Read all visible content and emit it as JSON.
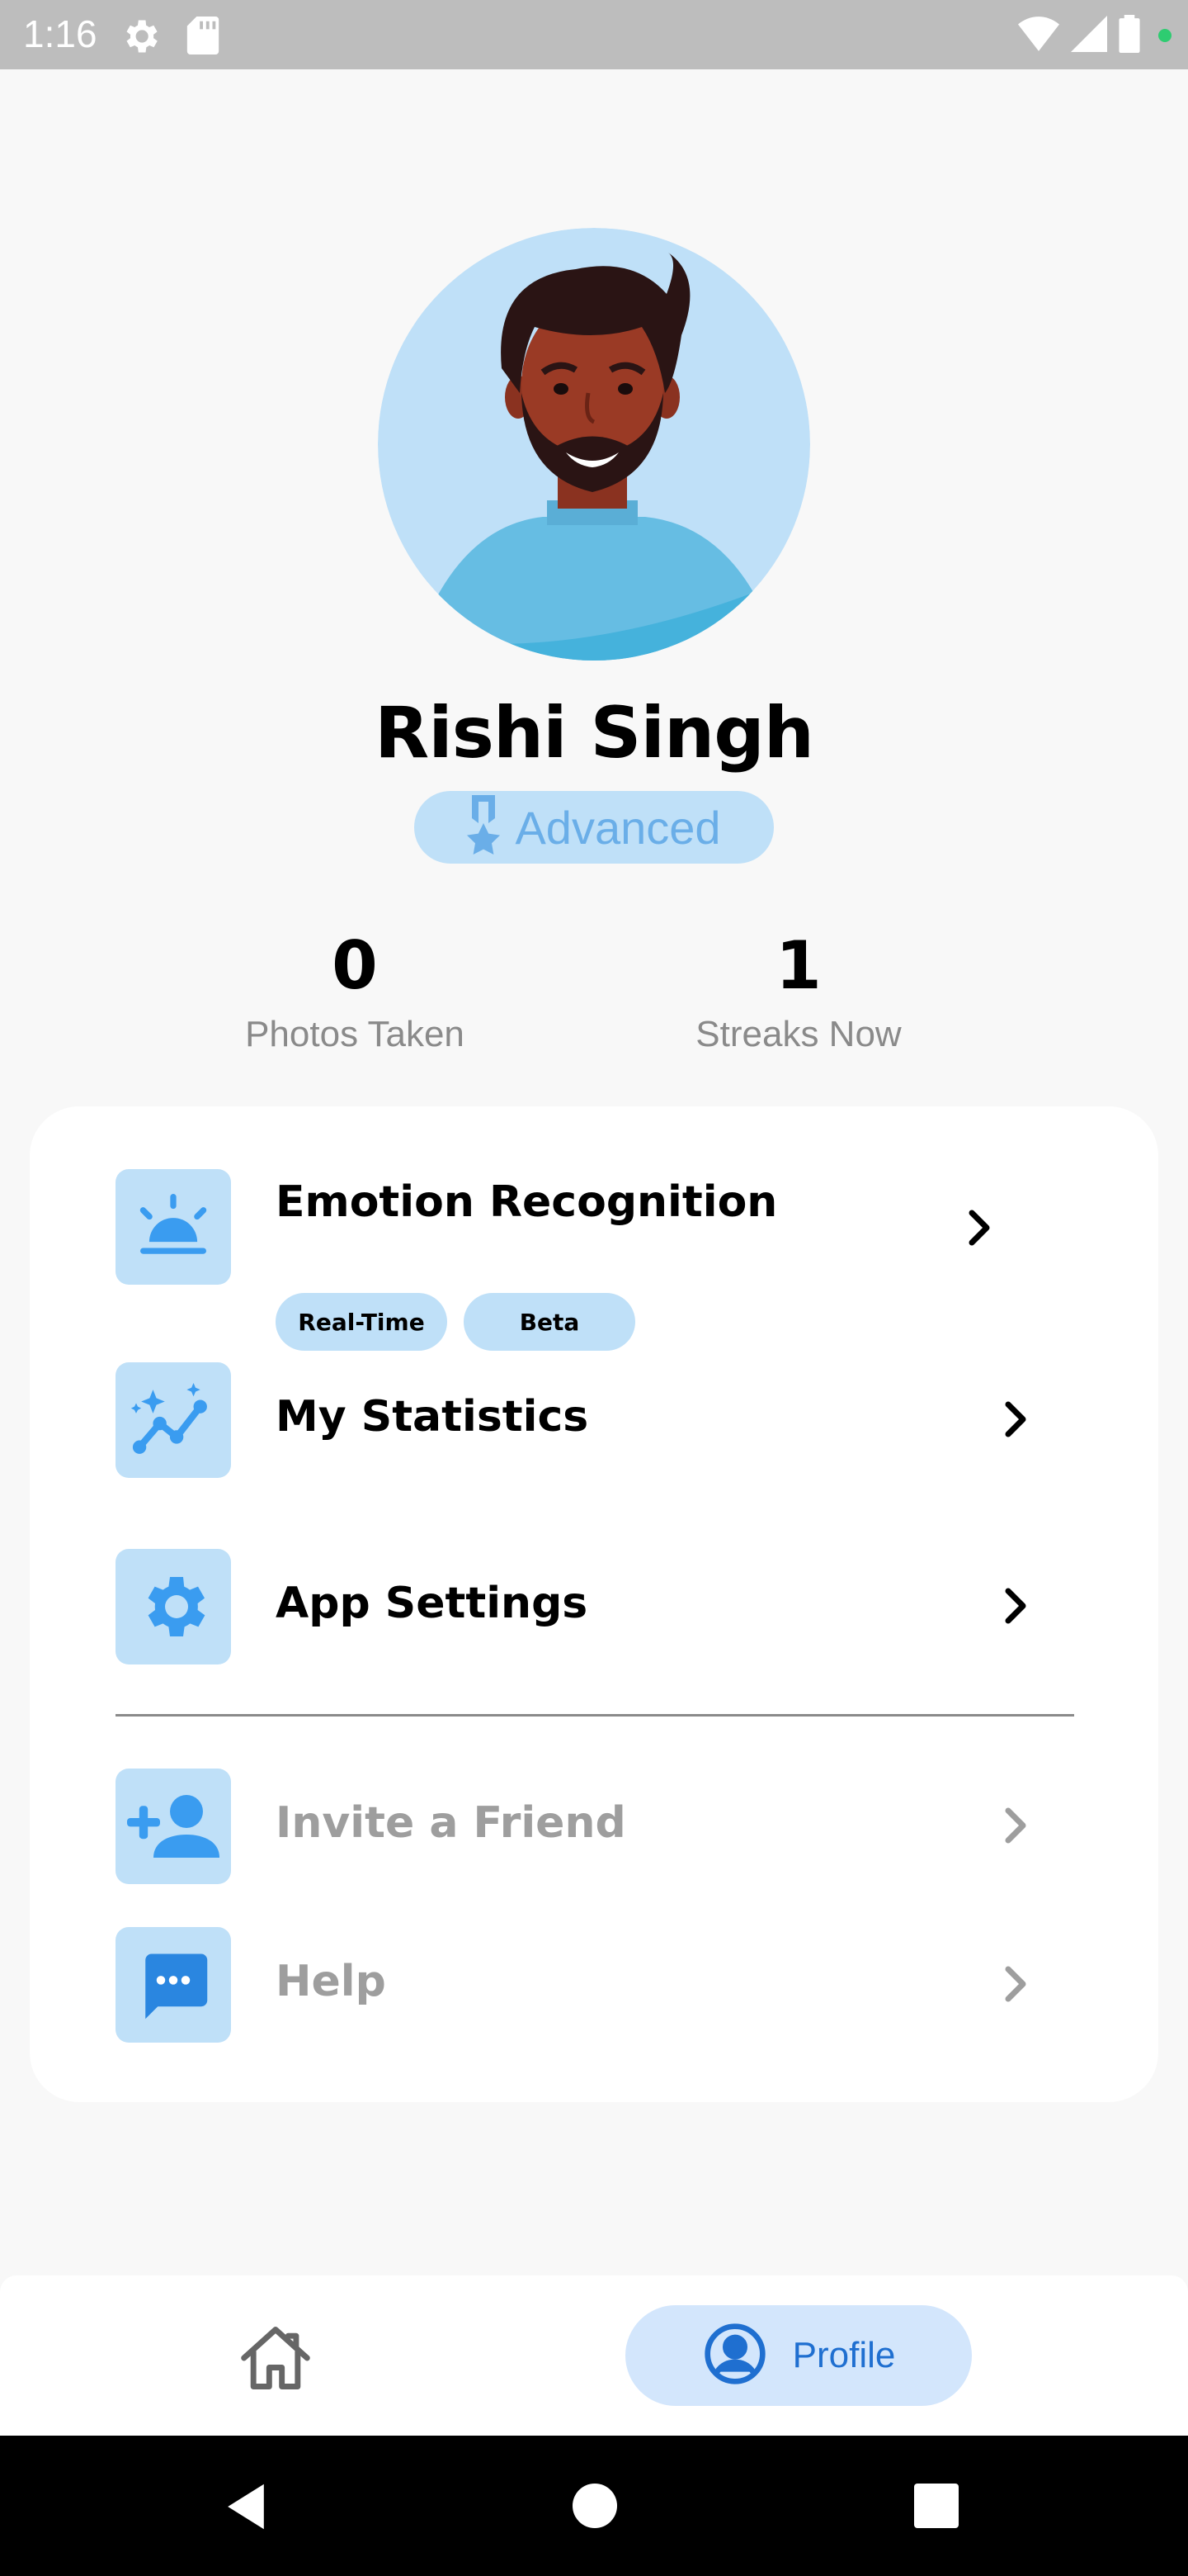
{
  "status_bar": {
    "time": "1:16"
  },
  "profile": {
    "name": "Rishi Singh",
    "level": "Advanced"
  },
  "stats": [
    {
      "value": "0",
      "label": "Photos Taken"
    },
    {
      "value": "1",
      "label": "Streaks Now"
    }
  ],
  "menu": {
    "items": [
      {
        "label": "Emotion Recognition",
        "icon": "sunrise-alarm-icon",
        "tags": [
          "Real-Time",
          "Beta"
        ]
      },
      {
        "label": "My Statistics",
        "icon": "chart-sparkle-icon"
      },
      {
        "label": "App Settings",
        "icon": "gear-icon"
      },
      {
        "label": "Invite a Friend",
        "icon": "add-person-icon"
      },
      {
        "label": "Help",
        "icon": "chat-bubble-icon"
      }
    ]
  },
  "bottom_nav": {
    "home_icon": "home-icon",
    "profile_label": "Profile",
    "active": "Profile"
  },
  "colors": {
    "accent_light": "#bfe0f8",
    "accent_icon": "#3a9cf0",
    "nav_active_bg": "#d3e6fc",
    "nav_active_fg": "#1f6fd0",
    "muted_text": "#9e9e9e"
  }
}
